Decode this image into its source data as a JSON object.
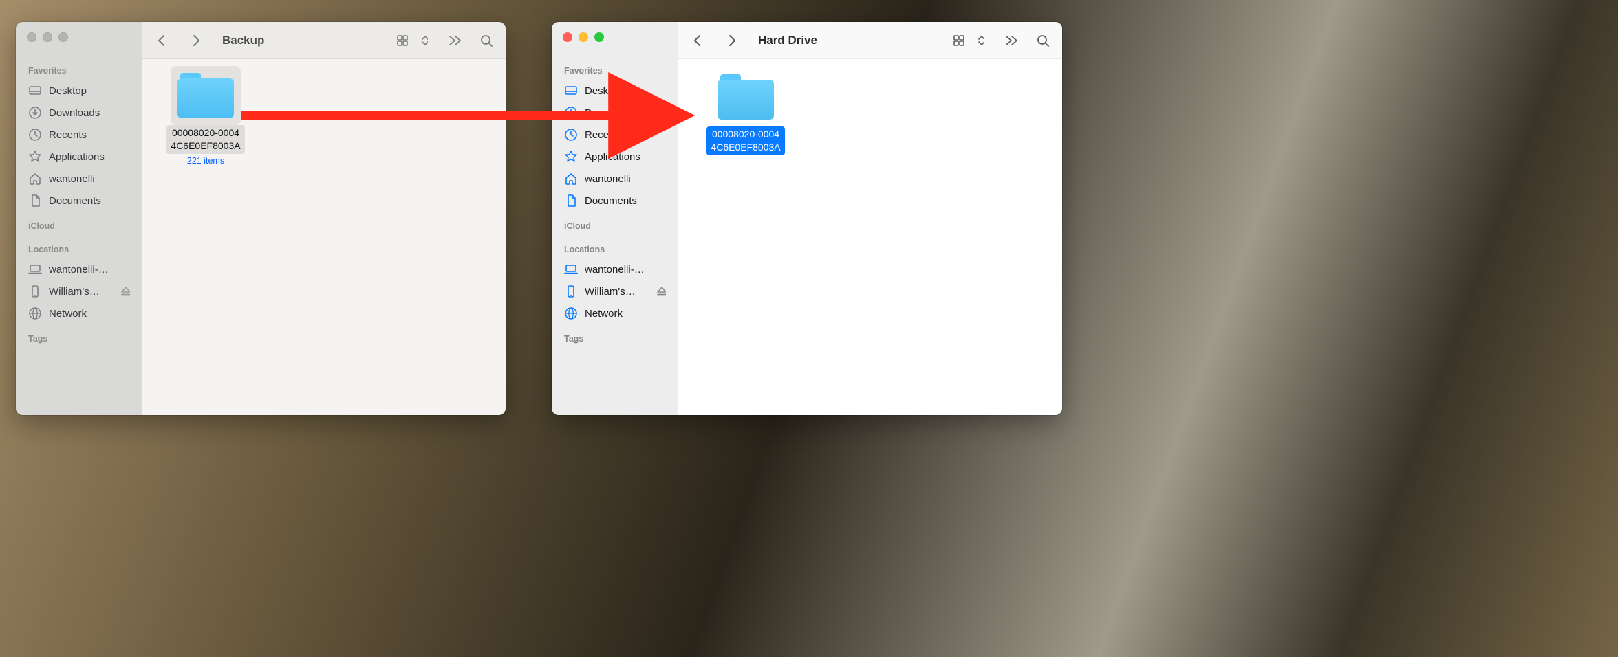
{
  "windows": {
    "left": {
      "title": "Backup",
      "inactive": true,
      "sidebar": {
        "favorites_label": "Favorites",
        "favorites": [
          {
            "icon": "desktop",
            "label": "Desktop"
          },
          {
            "icon": "download",
            "label": "Downloads"
          },
          {
            "icon": "clock",
            "label": "Recents"
          },
          {
            "icon": "apps",
            "label": "Applications"
          },
          {
            "icon": "home",
            "label": "wantonelli"
          },
          {
            "icon": "doc",
            "label": "Documents"
          }
        ],
        "icloud_label": "iCloud",
        "locations_label": "Locations",
        "locations": [
          {
            "icon": "laptop",
            "label": "wantonelli-…"
          },
          {
            "icon": "phone",
            "label": "William's…",
            "eject": true
          },
          {
            "icon": "globe",
            "label": "Network"
          }
        ],
        "tags_label": "Tags"
      },
      "item": {
        "name_line1": "00008020-0004",
        "name_line2": "4C6E0EF8003A",
        "sub": "221 items"
      }
    },
    "right": {
      "title": "Hard Drive",
      "inactive": false,
      "sidebar": {
        "favorites_label": "Favorites",
        "favorites": [
          {
            "icon": "desktop",
            "label": "Desktop"
          },
          {
            "icon": "download",
            "label": "Downloads"
          },
          {
            "icon": "clock",
            "label": "Recents"
          },
          {
            "icon": "apps",
            "label": "Applications"
          },
          {
            "icon": "home",
            "label": "wantonelli"
          },
          {
            "icon": "doc",
            "label": "Documents"
          }
        ],
        "icloud_label": "iCloud",
        "locations_label": "Locations",
        "locations": [
          {
            "icon": "laptop",
            "label": "wantonelli-…"
          },
          {
            "icon": "phone",
            "label": "William's…",
            "eject": true
          },
          {
            "icon": "globe",
            "label": "Network"
          }
        ],
        "tags_label": "Tags"
      },
      "item": {
        "name_line1": "00008020-0004",
        "name_line2": "4C6E0EF8003A"
      }
    }
  },
  "annotation": {
    "kind": "arrow",
    "color": "#ff2a1a"
  }
}
